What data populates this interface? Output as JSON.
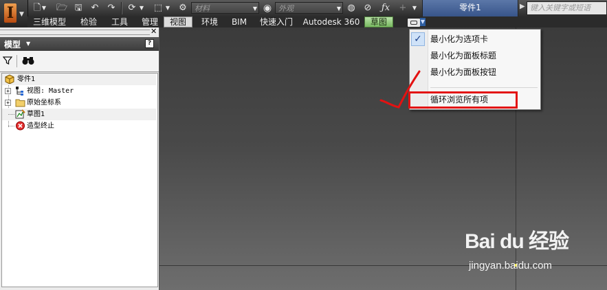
{
  "app": {
    "logo_letter": "I",
    "document_title": "零件1"
  },
  "qat": {
    "material_placeholder": "材料",
    "appearance_placeholder": "外观",
    "search_placeholder": "键入关键字或短语"
  },
  "ribbon_tabs": [
    {
      "label": "三维模型"
    },
    {
      "label": "检验"
    },
    {
      "label": "工具"
    },
    {
      "label": "管理"
    },
    {
      "label": "视图",
      "state": "active"
    },
    {
      "label": "环境"
    },
    {
      "label": "BIM"
    },
    {
      "label": "快速入门"
    },
    {
      "label": "Autodesk 360"
    },
    {
      "label": "草图",
      "state": "contextual"
    }
  ],
  "browser": {
    "title": "模型",
    "help_label": "?",
    "tree": [
      {
        "label": "零件1"
      },
      {
        "label": "视图: Master"
      },
      {
        "label": "原始坐标系"
      },
      {
        "label": "草图1"
      },
      {
        "label": "造型终止"
      }
    ]
  },
  "menu": {
    "items": [
      {
        "label": "最小化为选项卡",
        "checked": true
      },
      {
        "label": "最小化为面板标题",
        "checked": false
      },
      {
        "label": "最小化为面板按钮",
        "checked": false
      },
      {
        "label": "循环浏览所有项",
        "checked": false
      }
    ],
    "check_glyph": "✓"
  },
  "annotation": {
    "color": "#e31212"
  },
  "watermark": {
    "logo": "Bai du 经验",
    "url": "jingyan.baidu.com"
  }
}
